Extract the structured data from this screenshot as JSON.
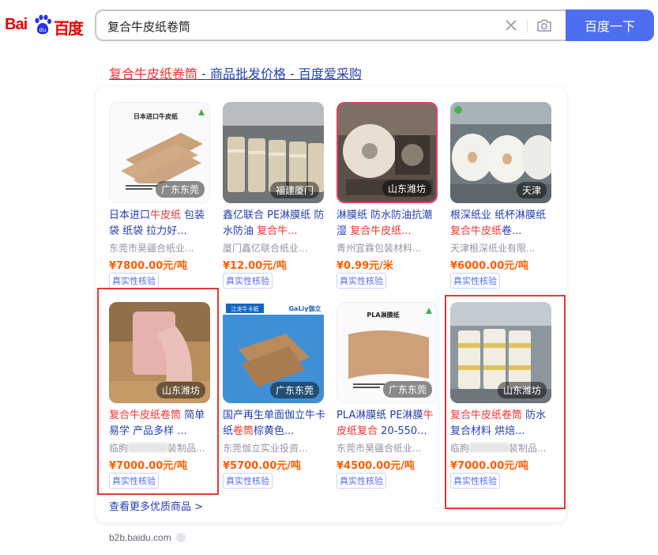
{
  "logo": {
    "part1": "Bai",
    "part2": "百度"
  },
  "search": {
    "query": "复合牛皮纸卷筒",
    "button_label": "百度一下"
  },
  "result": {
    "title_highlight": "复合牛皮纸卷筒",
    "title_rest": " - 商品批发价格 - 百度爱采购"
  },
  "products": [
    {
      "name_parts": [
        {
          "t": "日本进口",
          "r": false
        },
        {
          "t": "牛皮纸",
          "r": true
        },
        {
          "t": " 包装袋 纸袋 拉力好...",
          "r": false
        }
      ],
      "company": "东莞市昊疆合纸业...",
      "price": "¥7800.00元/吨",
      "location": "广东东莞",
      "badge": "真实性核验",
      "img_text": "日本进口牛皮纸"
    },
    {
      "name_parts": [
        {
          "t": "鑫亿联合 PE淋膜纸 防水防油 ",
          "r": false
        },
        {
          "t": "复合牛...",
          "r": true
        }
      ],
      "company": "厦门鑫亿联合纸业...",
      "price": "¥12.00元/吨",
      "location": "福建厦门",
      "badge": "真实性核验"
    },
    {
      "name_parts": [
        {
          "t": "淋膜纸 防水防油抗潮湿 ",
          "r": false
        },
        {
          "t": "复合牛皮纸...",
          "r": true
        }
      ],
      "company": "青州宜霖包装材料...",
      "price": "¥0.99元/米",
      "location": "山东潍坊",
      "badge": "真实性核验"
    },
    {
      "name_parts": [
        {
          "t": "根深纸业 纸杯淋膜纸 ",
          "r": false
        },
        {
          "t": "复合牛皮纸",
          "r": true
        },
        {
          "t": "卷...",
          "r": false
        }
      ],
      "company": "天津根深纸业有限...",
      "price": "¥6000.00元/吨",
      "location": "天津",
      "badge": "真实性核验"
    },
    {
      "name_parts": [
        {
          "t": "复合牛皮纸卷筒",
          "r": true
        },
        {
          "t": " 简单易学 产品多样 ...",
          "r": false
        }
      ],
      "company_pre": "临朐",
      "company_post": "装制品...",
      "price": "¥7000.00元/吨",
      "location": "山东潍坊",
      "badge": "真实性核验"
    },
    {
      "name_parts": [
        {
          "t": "国产再生单面伽立牛卡纸",
          "r": false
        },
        {
          "t": "卷筒",
          "r": true
        },
        {
          "t": "棕黄色...",
          "r": false
        }
      ],
      "company": "东莞伽立实业投资...",
      "price": "¥5700.00元/吨",
      "location": "广东东莞",
      "badge": "真实性核验",
      "img_text": "江龙牛卡纸",
      "img_logo": "GaLiy伽立"
    },
    {
      "name_parts": [
        {
          "t": "PLA淋膜纸 PE淋膜",
          "r": false
        },
        {
          "t": "牛皮纸复合",
          "r": true
        },
        {
          "t": " 20-550...",
          "r": false
        }
      ],
      "company": "东莞市昊疆合纸业...",
      "price": "¥4500.00元/吨",
      "location": "广东东莞",
      "badge": "真实性核验",
      "img_text": "PLA淋膜纸"
    },
    {
      "name_parts": [
        {
          "t": "复合牛皮纸卷筒",
          "r": true
        },
        {
          "t": " 防水复合材料 烘焙...",
          "r": false
        }
      ],
      "company_pre": "临朐",
      "company_post": "装制品...",
      "price": "¥7000.00元/吨",
      "location": "山东潍坊",
      "badge": "真实性核验"
    }
  ],
  "more_link": "查看更多优质商品 >",
  "source": "b2b.baidu.com",
  "colors": {
    "brand_red": "#e10601",
    "link_blue": "#2440b3",
    "highlight_red": "#f73131",
    "price_orange": "#ff5c00",
    "button_blue": "#4e6ef2"
  }
}
